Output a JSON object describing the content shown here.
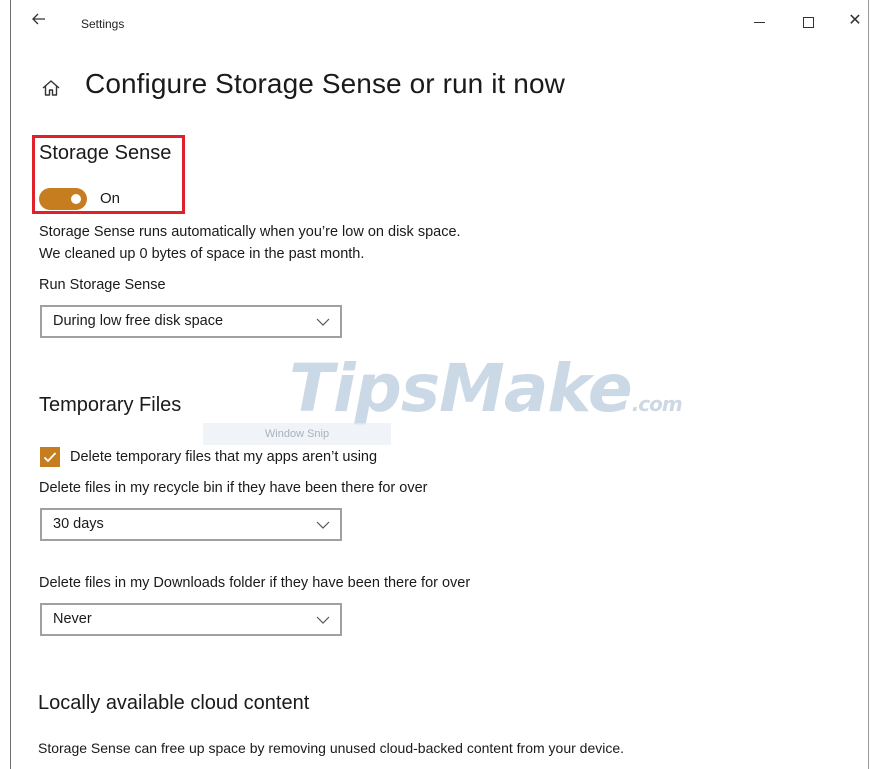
{
  "titlebar": {
    "back_icon": "back-arrow-icon",
    "app_title": "Settings",
    "minimize_icon": "minimize-icon",
    "maximize_icon": "maximize-icon",
    "close_icon": "close-icon",
    "close_glyph": "✕"
  },
  "page": {
    "home_icon": "home-icon",
    "title": "Configure Storage Sense or run it now"
  },
  "storage_sense": {
    "heading": "Storage Sense",
    "toggle_state": "On",
    "toggle_color": "#c67d1f",
    "highlight_color": "#e0202a",
    "description_line1": "Storage Sense runs automatically when you’re low on disk space.",
    "description_line2": "We cleaned up 0 bytes of space in the past month.",
    "run_label": "Run Storage Sense",
    "run_value": "During low free disk space"
  },
  "temporary_files": {
    "heading": "Temporary Files",
    "checkbox_label": "Delete temporary files that my apps aren’t using",
    "checkbox_checked": true,
    "recycle_label": "Delete files in my recycle bin if they have been there for over",
    "recycle_value": "30 days",
    "downloads_label": "Delete files in my Downloads folder if they have been there for over",
    "downloads_value": "Never"
  },
  "cloud_content": {
    "heading": "Locally available cloud content",
    "description": "Storage Sense can free up space by removing unused cloud-backed content from your device."
  },
  "watermark": {
    "brand": "TipsMake",
    "suffix": ".com",
    "snip_tip": "Window Snip"
  }
}
